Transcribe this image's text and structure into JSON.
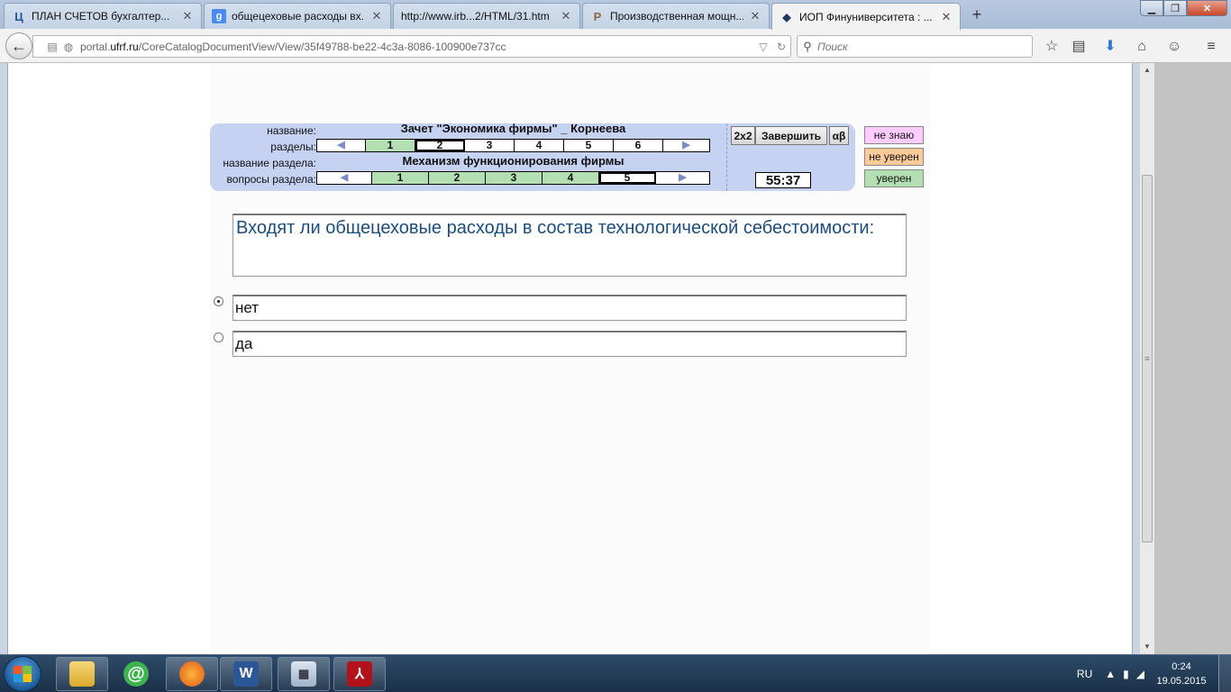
{
  "tabs": [
    {
      "title": "ПЛАН СЧЕТОВ бухгалтер...",
      "favicon": "Ц",
      "favicon_color": "#1e56a0"
    },
    {
      "title": "общецеховые расходы вх...",
      "favicon": "g",
      "favicon_color": "#4a8af4"
    },
    {
      "title": "http://www.irb...2/HTML/31.htm",
      "favicon": "",
      "favicon_color": ""
    },
    {
      "title": "Производственная мощн...",
      "favicon": "P",
      "favicon_color": "#8a6a3a"
    },
    {
      "title": "ИОП Финуниверситета : ...",
      "favicon": "◆",
      "favicon_color": "#1f3a5f"
    }
  ],
  "url": {
    "prefix": "portal.",
    "domain": "ufrf.ru",
    "path": "/CoreCatalogDocumentView/View/35f49788-be22-4c3a-8086-100900e737cc"
  },
  "search": {
    "placeholder": "Поиск"
  },
  "test_panel": {
    "label_name": "название:",
    "label_sections": "разделы:",
    "label_section_name": "название раздела:",
    "label_section_questions": "вопросы раздела:",
    "test_title": "Зачет \"Экономика фирмы\" _ Корнеева",
    "section_title": "Механизм функционирования  фирмы",
    "sections": [
      "1",
      "2",
      "3",
      "4",
      "5",
      "6"
    ],
    "questions": [
      "1",
      "2",
      "3",
      "4",
      "5"
    ],
    "btn_2x2": "2x2",
    "btn_finish": "Завершить",
    "btn_ab": "αβ",
    "timer": "55:37"
  },
  "confidence": {
    "dont_know": "не знаю",
    "unsure": "не уверен",
    "sure": "уверен"
  },
  "question": "Входят ли общецеховые расходы в состав технологической себестоимости:",
  "answers": [
    {
      "text": "нет",
      "selected": true
    },
    {
      "text": "да",
      "selected": false
    }
  ],
  "tray": {
    "lang": "RU",
    "time": "0:24",
    "date": "19.05.2015"
  },
  "colors": {
    "panel_bg": "#c6d2f2",
    "done_cell": "#b3e0b3",
    "question_text": "#1a4d80",
    "dont_know_bg": "#ffccff",
    "unsure_bg": "#ffcc99",
    "sure_bg": "#b3e0b3"
  }
}
